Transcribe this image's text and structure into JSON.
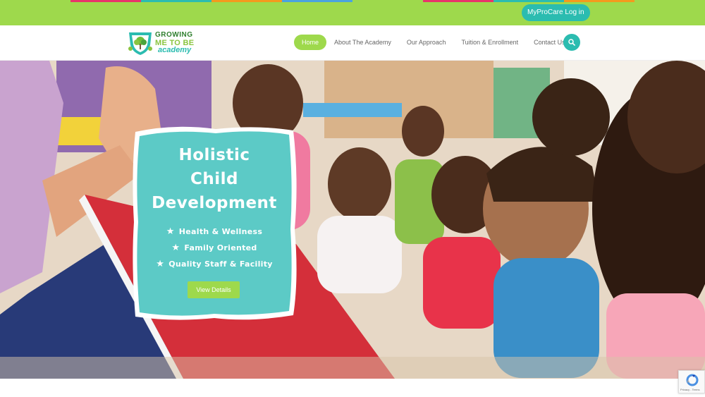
{
  "colors": {
    "strip": [
      "#9ed94c",
      "#e8346a",
      "#2bbcb0",
      "#f39a1e",
      "#4aa3df",
      "#9ed94c",
      "#e8346a",
      "#2bbcb0",
      "#f39a1e",
      "#9ed94c"
    ],
    "accent_green": "#9ed94c",
    "accent_teal": "#2bbcb0",
    "card_fill": "#5ccac6"
  },
  "topbar": {
    "login_label": "MyProCare Log in"
  },
  "logo": {
    "line1": "GROWING",
    "line2": "ME TO BE",
    "line3": "academy"
  },
  "nav": {
    "items": [
      {
        "label": "Home",
        "active": true
      },
      {
        "label": "About The Academy"
      },
      {
        "label": "Our Approach"
      },
      {
        "label": "Tuition & Enrollment"
      },
      {
        "label": "Contact Us"
      }
    ],
    "search_icon": "search-icon"
  },
  "hero": {
    "title_lines": [
      "Holistic",
      "Child",
      "Development"
    ],
    "features": [
      "Health & Wellness",
      "Family Oriented",
      "Quality Staff & Facility"
    ],
    "button_label": "View Details"
  },
  "recaptcha": {
    "label": "Privacy - Terms"
  }
}
